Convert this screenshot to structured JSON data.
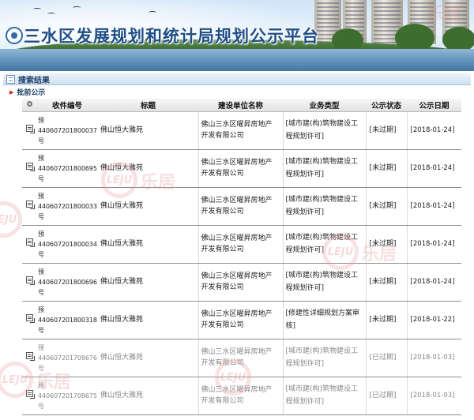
{
  "header": {
    "title": "三水区发展规划和统计局规划公示平台"
  },
  "section": {
    "title": "搜索结果",
    "sub_link": "批前公示"
  },
  "table": {
    "columns": [
      "收件编号",
      "标题",
      "建设单位名称",
      "业务类型",
      "公示状态",
      "公示日期"
    ],
    "rows": [
      {
        "id": "预\n440607201800037\n号",
        "title": "佛山恒大雅苑",
        "unit": "佛山三水区曜昇房地产\n开发有限公司",
        "type": "[城市建(构)筑物建设工\n程规划许可]",
        "status": "[未过期]",
        "date": "[2018-01-24]",
        "expired": false
      },
      {
        "id": "预\n440607201800695\n号",
        "title": "佛山恒大雅苑",
        "unit": "佛山三水区曜昇房地产\n开发有限公司",
        "type": "[城市建(构)筑物建设工\n程规划许可]",
        "status": "[未过期]",
        "date": "[2018-01-24]",
        "expired": false
      },
      {
        "id": "预\n440607201800033\n号",
        "title": "佛山恒大雅苑",
        "unit": "佛山三水区曜昇房地产\n开发有限公司",
        "type": "[城市建(构)筑物建设工\n程规划许可]",
        "status": "[未过期]",
        "date": "[2018-01-24]",
        "expired": false
      },
      {
        "id": "预\n440607201800034\n号",
        "title": "佛山恒大雅苑",
        "unit": "佛山三水区曜昇房地产\n开发有限公司",
        "type": "[城市建(构)筑物建设工\n程规划许可]",
        "status": "[未过期]",
        "date": "[2018-01-24]",
        "expired": false
      },
      {
        "id": "预\n440607201800696\n号",
        "title": "佛山恒大雅苑",
        "unit": "佛山三水区曜昇房地产\n开发有限公司",
        "type": "[城市建(构)筑物建设工\n程规划许可]",
        "status": "[未过期]",
        "date": "[2018-01-24]",
        "expired": false
      },
      {
        "id": "预\n440607201800318\n号",
        "title": "佛山恒大雅苑",
        "unit": "佛山三水区曜昇房地产\n开发有限公司",
        "type": "[修建性详细规划方案审\n核]",
        "status": "[未过期]",
        "date": "[2018-01-22]",
        "expired": false
      },
      {
        "id": "预\n440607201708676\n号",
        "title": "佛山恒大雅苑",
        "unit": "佛山三水区曜昇房地产\n开发有限公司",
        "type": "[城市建(构)筑物建设工\n程规划许可]",
        "status": "[已过期]",
        "date": "[2018-01-03]",
        "expired": true
      },
      {
        "id": "预\n440607201708675\n号",
        "title": "佛山恒大雅苑",
        "unit": "佛山三水区曜昇房地产\n开发有限公司",
        "type": "[城市建(构)筑物建设工\n程规划许可]",
        "status": "[已过期]",
        "date": "[2018-01-03]",
        "expired": true
      }
    ]
  },
  "watermark": {
    "logo_text": "LEJU",
    "brand_text": "乐居"
  },
  "colors": {
    "title_blue": "#1f4f86",
    "link_red": "#c2241b",
    "expired_gray": "#888888"
  }
}
